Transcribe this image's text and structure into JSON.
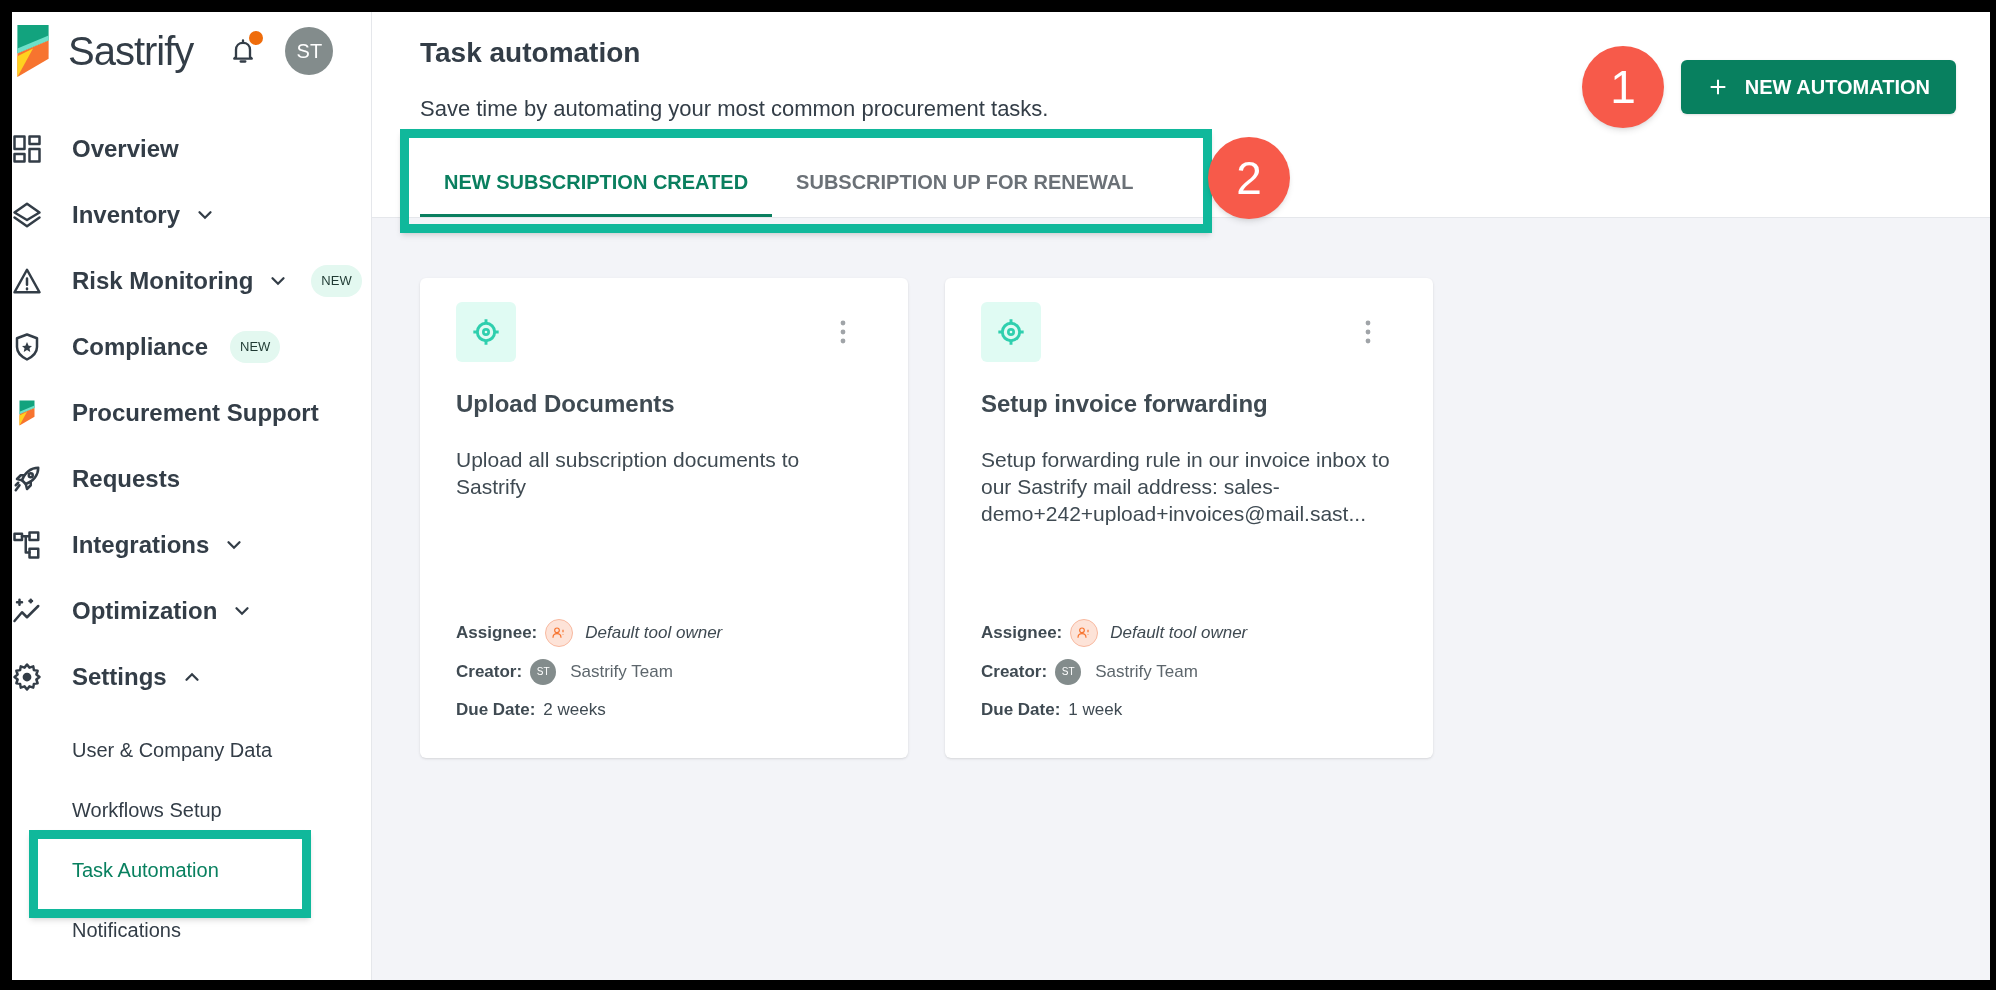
{
  "app": {
    "brand": "Sastrify",
    "avatar": "ST"
  },
  "sidebar": {
    "items": [
      {
        "label": "Overview",
        "selected": false
      },
      {
        "label": "Inventory",
        "selected": false,
        "expanded": false
      },
      {
        "label": "Risk Monitoring",
        "selected": false,
        "expanded": false,
        "badge": "NEW"
      },
      {
        "label": "Compliance",
        "selected": false,
        "badge": "NEW"
      },
      {
        "label": "Procurement Support",
        "selected": false
      },
      {
        "label": "Requests",
        "selected": false
      },
      {
        "label": "Integrations",
        "selected": false,
        "expanded": false
      },
      {
        "label": "Optimization",
        "selected": false,
        "expanded": false
      },
      {
        "label": "Settings",
        "selected": false,
        "expanded": true,
        "children": [
          {
            "label": "User & Company Data",
            "selected": false
          },
          {
            "label": "Workflows Setup",
            "selected": false
          },
          {
            "label": "Task Automation",
            "selected": true
          },
          {
            "label": "Notifications",
            "selected": false
          }
        ]
      }
    ]
  },
  "page": {
    "title": "Task automation",
    "subtitle": "Save time by automating your most common procurement tasks.",
    "new_button": "NEW AUTOMATION"
  },
  "tabs": [
    {
      "label": "NEW SUBSCRIPTION CREATED",
      "selected": true
    },
    {
      "label": "SUBSCRIPTION UP FOR RENEWAL",
      "selected": false
    }
  ],
  "cards": [
    {
      "title": "Upload Documents",
      "description": "Upload all subscription documents to Sastrify",
      "assignee_label": "Assignee:",
      "assignee": "Default tool owner",
      "creator_label": "Creator:",
      "creator_initials": "ST",
      "creator": "Sastrify Team",
      "due_label": "Due Date:",
      "due": "2 weeks"
    },
    {
      "title": "Setup invoice forwarding",
      "description": "Setup forwarding rule in our invoice inbox to our Sastrify mail address: sales-demo+242+upload+invoices@mail.sast...",
      "assignee_label": "Assignee:",
      "assignee": "Default tool owner",
      "creator_label": "Creator:",
      "creator_initials": "ST",
      "creator": "Sastrify Team",
      "due_label": "Due Date:",
      "due": "1 week"
    }
  ],
  "annotations": [
    {
      "number": "1"
    },
    {
      "number": "2"
    }
  ]
}
